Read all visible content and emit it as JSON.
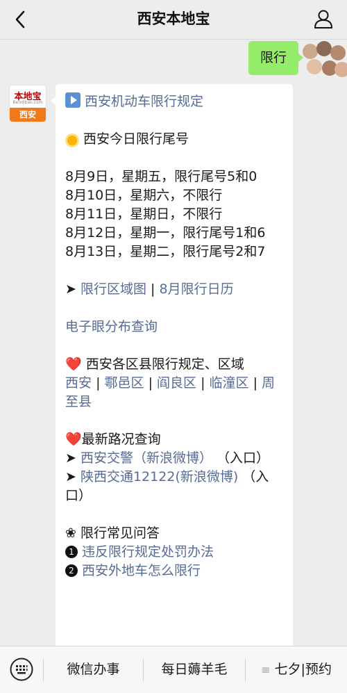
{
  "header": {
    "title": "西安本地宝",
    "back_icon": "chevron-left-icon",
    "profile_icon": "person-icon"
  },
  "user_message": {
    "text": "限行"
  },
  "bot_avatar": {
    "logo_text": "本地宝",
    "logo_sub": "Bendibao.com",
    "city": "西安"
  },
  "message": {
    "rules_link": "西安机动车限行规定",
    "today_heading": "西安今日限行尾号",
    "schedule": [
      "8月9日，星期五，限行尾号5和0",
      "8月10日，星期六，不限行",
      "8月11日，星期日，不限行",
      "8月12日，星期一，限行尾号1和6",
      "8月13日，星期二，限行尾号2和7"
    ],
    "arrow": "➤",
    "map_link": "限行区域图",
    "sep": "|",
    "calendar_link": "8月限行日历",
    "camera_link": "电子眼分布查询",
    "heart": "❤️",
    "districts_heading": "西安各区县限行规定、区域",
    "districts": [
      "西安",
      "鄠邑区",
      "阎良区",
      "临潼区",
      "周至县"
    ],
    "traffic_heading": "最新路况查询",
    "traffic_links": [
      {
        "link": "西安交警（新浪微博）",
        "suffix": "（入口）"
      },
      {
        "link": "陕西交通12122(新浪微博)",
        "suffix": "（入口）"
      }
    ],
    "faq_bullet": "❀",
    "faq_heading": "限行常见问答",
    "faq": [
      {
        "num": "1",
        "text": "违反限行规定处罚办法"
      },
      {
        "num": "2",
        "text": "西安外地车怎么限行"
      }
    ]
  },
  "bottom_menu": {
    "keyboard_icon": "keyboard-icon",
    "items": [
      "微信办事",
      "每日薅羊毛",
      "七夕|预约"
    ],
    "menu_icon_glyph": "≡"
  },
  "colors": {
    "link": "#576b95",
    "user_bubble": "#95ec69",
    "background": "#ededed"
  }
}
